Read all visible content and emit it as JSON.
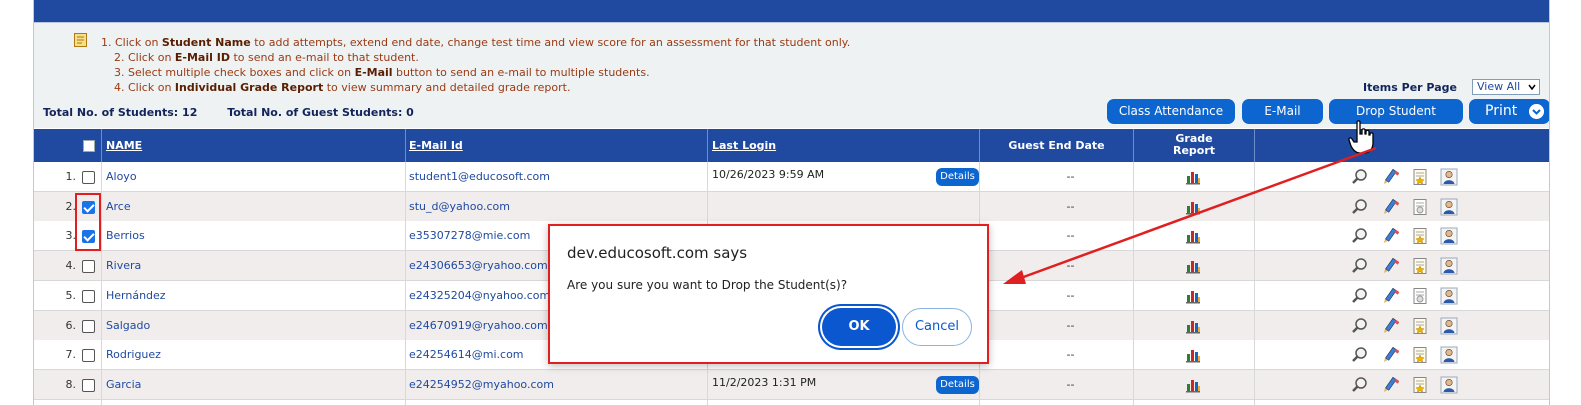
{
  "instructions": [
    {
      "num": "1.",
      "pre": "Click on ",
      "bold": "Student Name",
      "post": " to add attempts, extend end date, change test time and view score for an assessment for that student only."
    },
    {
      "num": "2.",
      "pre": "Click on ",
      "bold": "E-Mail ID",
      "post": " to send an e-mail to that student."
    },
    {
      "num": "3.",
      "pre": "Select multiple check boxes and click on ",
      "bold": "E-Mail",
      "post": " button to send an e-mail to multiple students."
    },
    {
      "num": "4.",
      "pre": "Click on ",
      "bold": "Individual Grade Report",
      "post": " to view summary and detailed grade report."
    }
  ],
  "items_per_page": {
    "label": "Items Per Page",
    "value": "View All"
  },
  "totals": {
    "students": "Total No. of Students: 12",
    "guests": "Total No. of Guest Students: 0"
  },
  "buttons": {
    "attendance": "Class Attendance",
    "email": "E-Mail",
    "drop": "Drop Student",
    "print": "Print"
  },
  "columns": {
    "name": "NAME",
    "email": "E-Mail Id",
    "last_login": "Last Login",
    "guest_end": "Guest End Date",
    "grade_l1": "Grade",
    "grade_l2": "Report"
  },
  "rows": [
    {
      "num": "1.",
      "checked": false,
      "name": "Aloyo",
      "email": "student1@educosoft.com",
      "login": "10/26/2023 9:59 AM",
      "details": "Details",
      "guest": "--"
    },
    {
      "num": "2.",
      "checked": true,
      "name": "Arce",
      "email": "stu_d@yahoo.com",
      "login": "",
      "details": "",
      "guest": "--"
    },
    {
      "num": "3.",
      "checked": true,
      "name": "Berrios",
      "email": "e35307278@mie.com",
      "login": "",
      "details": "",
      "guest": "--"
    },
    {
      "num": "4.",
      "checked": false,
      "name": "Rivera",
      "email": "e24306653@ryahoo.com",
      "login": "",
      "details": "",
      "guest": "--"
    },
    {
      "num": "5.",
      "checked": false,
      "name": "Hernández",
      "email": "e24325204@nyahoo.com",
      "login": "",
      "details": "",
      "guest": "--"
    },
    {
      "num": "6.",
      "checked": false,
      "name": "Salgado",
      "email": "e24670919@ryahoo.com",
      "login": "",
      "details": "",
      "guest": "--"
    },
    {
      "num": "7.",
      "checked": false,
      "name": "Rodriguez",
      "email": "e24254614@mi.com",
      "login": "",
      "details": "",
      "guest": "--"
    },
    {
      "num": "8.",
      "checked": false,
      "name": "Garcia",
      "email": "e24254952@myahoo.com",
      "login": "11/2/2023 1:31 PM",
      "details": "Details",
      "guest": "--"
    }
  ],
  "dialog": {
    "title": "dev.educosoft.com says",
    "message": "Are you sure you want to Drop the Student(s)?",
    "ok": "OK",
    "cancel": "Cancel"
  },
  "colors": {
    "header_blue": "#1f4aa0",
    "button_blue": "#0d66d0",
    "highlight_red": "#e02020",
    "instruction_text": "#9a3a12"
  }
}
